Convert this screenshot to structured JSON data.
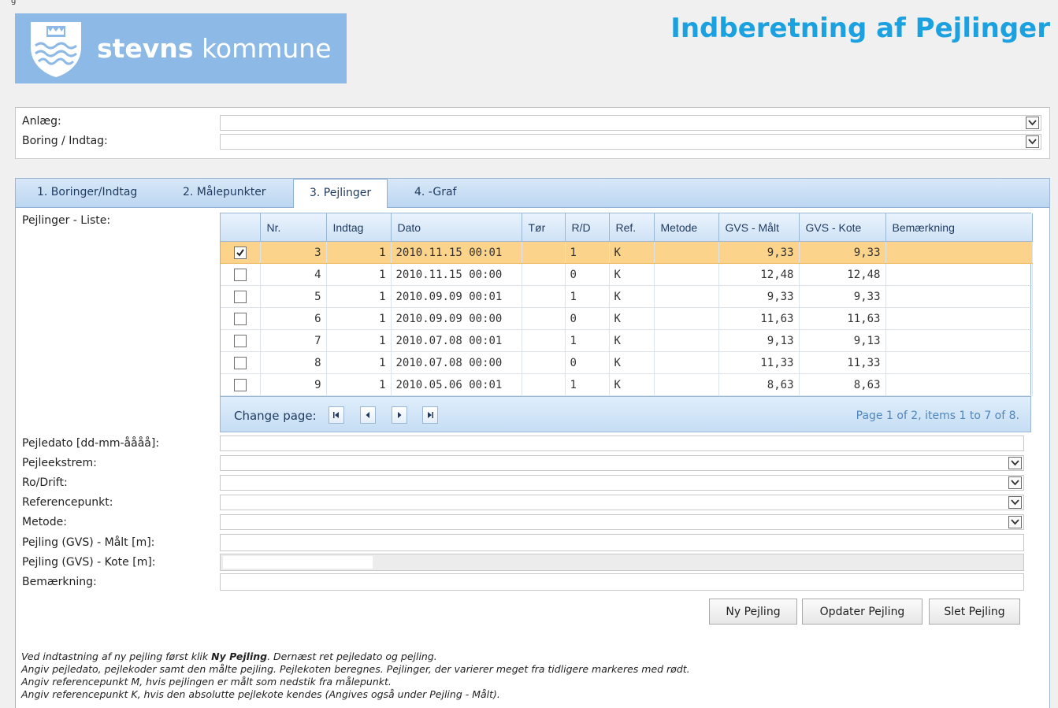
{
  "header": {
    "logo_text_bold": "stevns",
    "logo_text_light": "kommune",
    "page_title": "Indberetning af Pejlinger"
  },
  "selection": {
    "anlaeg_label": "Anlæg:",
    "boring_label": "Boring / Indtag:"
  },
  "tabs": [
    {
      "label": "1. Boringer/Indtag"
    },
    {
      "label": "2. Målepunkter"
    },
    {
      "label": "3. Pejlinger"
    },
    {
      "label": "4. -Graf"
    }
  ],
  "list_label": "Pejlinger - Liste:",
  "grid": {
    "columns": [
      "Nr.",
      "Indtag",
      "Dato",
      "Tør",
      "R/D",
      "Ref.",
      "Metode",
      "GVS - Målt",
      "GVS - Kote",
      "Bemærkning"
    ],
    "rows": [
      {
        "checked": true,
        "nr": "3",
        "indtag": "1",
        "dato": "2010.11.15 00:01",
        "tor": "",
        "rd": "1",
        "ref": "K",
        "metode": "",
        "gvs_malt": "9,33",
        "gvs_kote": "9,33",
        "bem": ""
      },
      {
        "checked": false,
        "nr": "4",
        "indtag": "1",
        "dato": "2010.11.15 00:00",
        "tor": "",
        "rd": "0",
        "ref": "K",
        "metode": "",
        "gvs_malt": "12,48",
        "gvs_kote": "12,48",
        "bem": ""
      },
      {
        "checked": false,
        "nr": "5",
        "indtag": "1",
        "dato": "2010.09.09 00:01",
        "tor": "",
        "rd": "1",
        "ref": "K",
        "metode": "",
        "gvs_malt": "9,33",
        "gvs_kote": "9,33",
        "bem": ""
      },
      {
        "checked": false,
        "nr": "6",
        "indtag": "1",
        "dato": "2010.09.09 00:00",
        "tor": "",
        "rd": "0",
        "ref": "K",
        "metode": "",
        "gvs_malt": "11,63",
        "gvs_kote": "11,63",
        "bem": ""
      },
      {
        "checked": false,
        "nr": "7",
        "indtag": "1",
        "dato": "2010.07.08 00:01",
        "tor": "",
        "rd": "1",
        "ref": "K",
        "metode": "",
        "gvs_malt": "9,13",
        "gvs_kote": "9,13",
        "bem": ""
      },
      {
        "checked": false,
        "nr": "8",
        "indtag": "1",
        "dato": "2010.07.08 00:00",
        "tor": "",
        "rd": "0",
        "ref": "K",
        "metode": "",
        "gvs_malt": "11,33",
        "gvs_kote": "11,33",
        "bem": ""
      },
      {
        "checked": false,
        "nr": "9",
        "indtag": "1",
        "dato": "2010.05.06 00:01",
        "tor": "",
        "rd": "1",
        "ref": "K",
        "metode": "",
        "gvs_malt": "8,63",
        "gvs_kote": "8,63",
        "bem": ""
      }
    ],
    "pager_label": "Change page:",
    "pager_info": "Page 1 of 2, items 1 to 7 of 8."
  },
  "form": {
    "pejledato_label": "Pejledato [dd-mm-åååå]:",
    "pejleekstrem_label": "Pejleekstrem:",
    "rodrift_label": "Ro/Drift:",
    "referencepunkt_label": "Referencepunkt:",
    "metode_label": "Metode:",
    "malt_label": "Pejling (GVS) - Målt [m]:",
    "kote_label": "Pejling (GVS) - Kote [m]:",
    "bemaerkning_label": "Bemærkning:"
  },
  "buttons": {
    "ny": "Ny Pejling",
    "opdater": "Opdater Pejling",
    "slet": "Slet Pejling"
  },
  "help": {
    "line1_pre": "Ved indtastning af ny pejling først klik ",
    "line1_bold": "Ny Pejling",
    "line1_post": ". Dernæst ret pejledato og pejling.",
    "line2": "Angiv pejledato, pejlekoder samt den målte pejling. Pejlekoten beregnes. Pejlinger, der varierer meget fra tidligere markeres med rødt.",
    "line3": "Angiv referencepunkt M, hvis pejlingen er målt som nedstik fra målepunkt.",
    "line4": "Angiv referencepunkt K, hvis den absolutte pejlekote kendes (Angives også under Pejling - Målt)."
  }
}
